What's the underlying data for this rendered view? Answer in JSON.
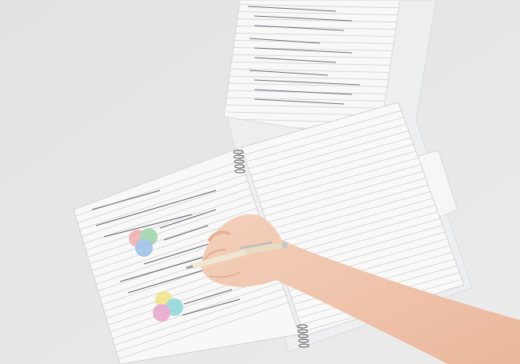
{
  "scene": {
    "description_colors": {
      "background": "#e4e4e4",
      "paper": "#f7f7f5",
      "rule_lines": "#c9cdd6",
      "ink": "#555a66",
      "skin": "#f0c7ae",
      "pen_body": "#efe6d2",
      "pen_metal": "#b9bcc2"
    },
    "venn_colors": [
      "#f2a3a8",
      "#8fd0a0",
      "#8fb8e6",
      "#f3e07a",
      "#7fd3d8",
      "#e69ac8"
    ]
  }
}
